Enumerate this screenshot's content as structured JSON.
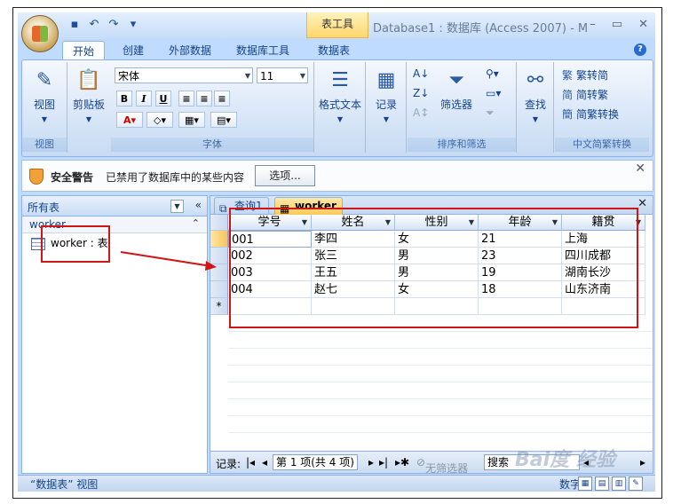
{
  "title_bar": {
    "context_tab": "表工具",
    "window_title": "Database1 : 数据库 (Access 2007) - M",
    "controls": [
      "–",
      "▭",
      "✕"
    ]
  },
  "ribbon_tabs": [
    "开始",
    "创建",
    "外部数据",
    "数据库工具",
    "数据表"
  ],
  "ribbon": {
    "view": {
      "label": "视图",
      "group": "视图"
    },
    "clipboard": {
      "label": "剪贴板"
    },
    "font": {
      "name": "宋体",
      "size": "11",
      "group": "字体",
      "bold": "B",
      "italic": "I",
      "underline": "U"
    },
    "rich_text": {
      "label": "格式文本"
    },
    "records": {
      "label": "记录"
    },
    "sort_filter": {
      "filter_label": "筛选器",
      "group": "排序和筛选"
    },
    "find": {
      "label": "查找"
    },
    "chinese_conversion": {
      "to_simplified": "繁转简",
      "to_traditional": "简转繁",
      "convert": "简繁转换",
      "group": "中文简繁转换"
    }
  },
  "message_bar": {
    "title": "安全警告",
    "text": "已禁用了数据库中的某些内容",
    "button": "选项..."
  },
  "nav_pane": {
    "header": "所有表",
    "group": "worker",
    "item": "worker : 表"
  },
  "doc_tabs": [
    "查询1",
    "worker"
  ],
  "table": {
    "columns": [
      "学号",
      "姓名",
      "性别",
      "年龄",
      "籍贯"
    ],
    "rows": [
      [
        "001",
        "李四",
        "女",
        "21",
        "上海"
      ],
      [
        "002",
        "张三",
        "男",
        "23",
        "四川成都"
      ],
      [
        "003",
        "王五",
        "男",
        "19",
        "湖南长沙"
      ],
      [
        "004",
        "赵七",
        "女",
        "18",
        "山东济南"
      ]
    ],
    "new_row_marker": "*"
  },
  "record_nav": {
    "label": "记录:",
    "position": "第 1 项(共 4 项)",
    "filter": "无筛选器",
    "search": "搜索"
  },
  "status_bar": {
    "left": "“数据表” 视图",
    "right": "数字"
  },
  "watermark": "Bai度 经验"
}
